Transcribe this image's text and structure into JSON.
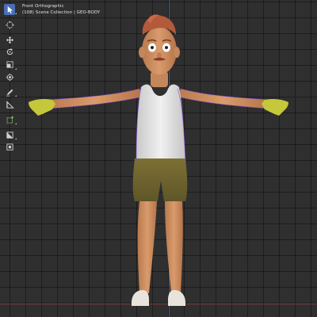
{
  "viewport": {
    "view_name": "Front Orthographic",
    "collection_info": "(108) Scene Collection | GEO-BODY"
  },
  "toolbar": {
    "tools": [
      "select-box",
      "cursor",
      "move",
      "rotate",
      "scale",
      "transform",
      "annotate",
      "measure",
      "add-cube",
      "extrude",
      "inset"
    ]
  },
  "colors": {
    "grid_background": "#2f2f2f",
    "z_axis": "#3d63a8",
    "x_axis": "#8c3b45",
    "active_tool": "#4a6fb5"
  }
}
